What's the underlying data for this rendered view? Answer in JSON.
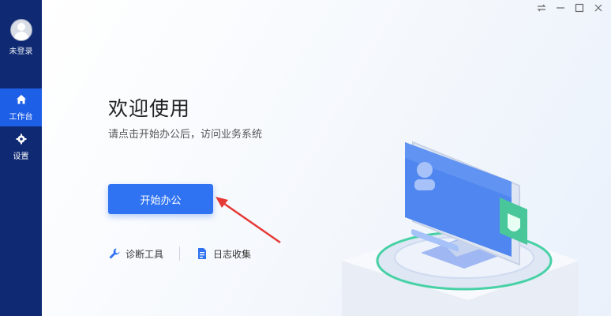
{
  "sidebar": {
    "user_label": "未登录",
    "items": [
      {
        "label": "工作台",
        "icon": "home-icon",
        "active": true
      },
      {
        "label": "设置",
        "icon": "gear-icon",
        "active": false
      }
    ]
  },
  "window": {
    "controls": [
      "pin-icon",
      "minimize-icon",
      "maximize-icon",
      "close-icon"
    ]
  },
  "main": {
    "title": "欢迎使用",
    "subtitle": "请点击开始办公后，访问业务系统",
    "start_button": "开始办公",
    "tools": [
      {
        "label": "诊断工具",
        "icon": "wrench-icon"
      },
      {
        "label": "日志收集",
        "icon": "document-icon"
      }
    ]
  },
  "colors": {
    "sidebar_bg": "#0f2a73",
    "active_bg": "#1e5fe8",
    "accent": "#2f73f2",
    "arrow": "#e53935"
  }
}
